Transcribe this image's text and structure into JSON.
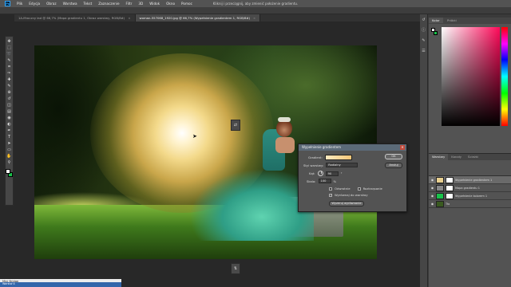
{
  "app": {
    "logo": "Ps",
    "window_hint": "Kliknij i przeciągnij, aby zmienić położenie gradientu."
  },
  "menu": [
    "Plik",
    "Edycja",
    "Obraz",
    "Warstwa",
    "Tekst",
    "Zaznaczenie",
    "Filtr",
    "3D",
    "Widok",
    "Okno",
    "Pomoc"
  ],
  "tabs": [
    {
      "label": "1A-Mroczny ład @ 66,7% (Mapa gradientu 1, Obraz warstwy, RGB/8#)",
      "active": false
    },
    {
      "label": "woman-557068_1920.jpg @ 66,7% (Wypełnienie gradientem 1, RGB/8#)",
      "active": true
    }
  ],
  "toolbar": {
    "icons": [
      "move-icon",
      "marquee-icon",
      "lasso-icon",
      "quick-select-icon",
      "crop-icon",
      "eyedropper-icon",
      "healing-icon",
      "brush-icon",
      "stamp-icon",
      "history-brush-icon",
      "eraser-icon",
      "gradient-icon",
      "blur-icon",
      "dodge-icon",
      "pen-icon",
      "type-icon",
      "path-select-icon",
      "shape-icon",
      "hand-icon",
      "zoom-icon"
    ],
    "glyphs": [
      "✥",
      "⬚",
      "➰",
      "✎",
      "⌗",
      "✑",
      "✚",
      "✎",
      "⊕",
      "↺",
      "◫",
      "▤",
      "◉",
      "◐",
      "✒",
      "T",
      "➤",
      "▭",
      "✋",
      "⚲"
    ],
    "fg_color": "#ffffff",
    "bg_color": "#18c24a"
  },
  "dialog": {
    "title": "Wypełnienie gradientem",
    "close": "✕",
    "gradient_label": "Gradient:",
    "style_label": "Styl warstwy:",
    "style_value": "Radialny",
    "angle_label": "Kąt:",
    "angle_value": "90",
    "angle_unit": "°",
    "scale_label": "Skala:",
    "scale_value": "100",
    "scale_unit": "%",
    "reverse_label": "Odwrotnie",
    "reverse_checked": false,
    "dither_label": "Roztrząsanie",
    "dither_checked": false,
    "align_label": "Wyrównaj do warstwy",
    "align_checked": true,
    "check_mark": "✓",
    "ok": "OK",
    "cancel": "Anuluj",
    "reset": "Wyzeruj wyrównanie"
  },
  "color_panel": {
    "tabs": [
      "Kolor",
      "Próbki"
    ],
    "hue_color": "#ff0a5a"
  },
  "layers_panel": {
    "tabs": [
      "Warstwy",
      "Kanały",
      "Ścieżki"
    ],
    "eye": "◉",
    "layers": [
      {
        "name": "Wypełnienie gradientem 1",
        "selected": true,
        "thumb": "#e8d090"
      },
      {
        "name": "Mapa gradientu 1",
        "selected": false,
        "thumb": "#888888"
      },
      {
        "name": "Wypełnienie kolorem 1",
        "selected": false,
        "thumb": "#18c24a"
      },
      {
        "name": "Tło",
        "selected": false,
        "thumb": "#3a5a20"
      }
    ]
  },
  "float_buttons": {
    "top": "⇄",
    "bottom": "⇅"
  },
  "bottom": {
    "text": "Mini Bridge",
    "sub": "Warstw 4"
  }
}
